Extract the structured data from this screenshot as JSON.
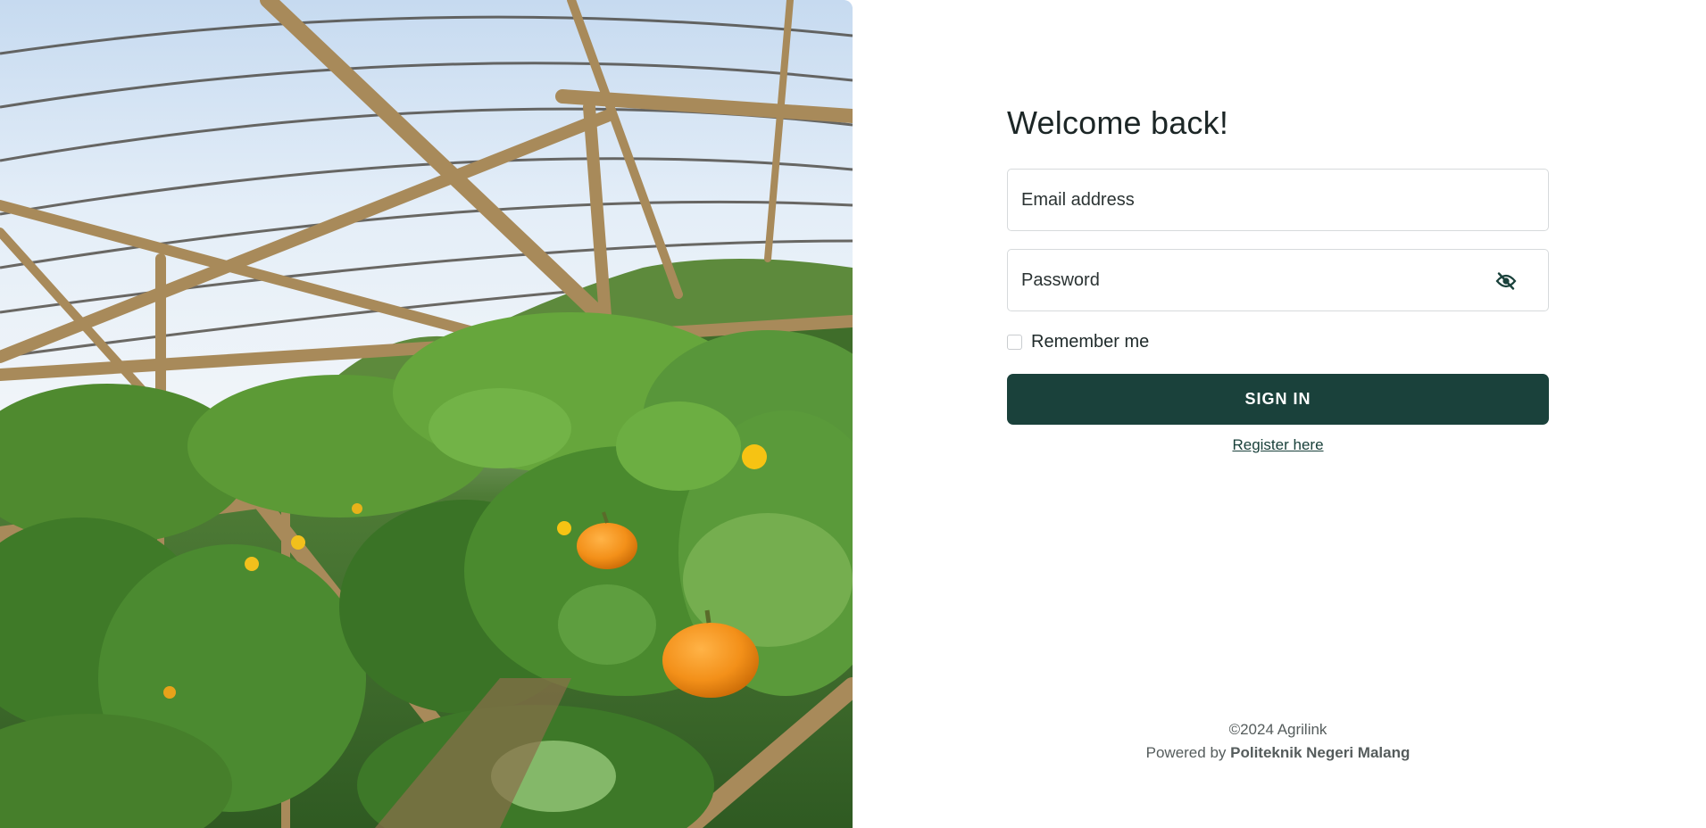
{
  "hero": {
    "image_description_icon": "greenhouse-pumpkin-photo"
  },
  "login": {
    "title": "Welcome back!",
    "email": {
      "placeholder": "Email address",
      "value": ""
    },
    "password": {
      "placeholder": "Password",
      "value": "",
      "toggle_icon": "eye-off-icon"
    },
    "remember_label": "Remember me",
    "remember_checked": false,
    "signin_label": "SIGN IN",
    "register_label": "Register here"
  },
  "footer": {
    "copyright": "©2024 Agrilink",
    "powered_prefix": "Powered by",
    "powered_by": "Politeknik Negeri Malang"
  },
  "colors": {
    "primary": "#1a413b",
    "text": "#1f2a2a",
    "muted": "#555c5c",
    "border": "#d7dadc"
  }
}
